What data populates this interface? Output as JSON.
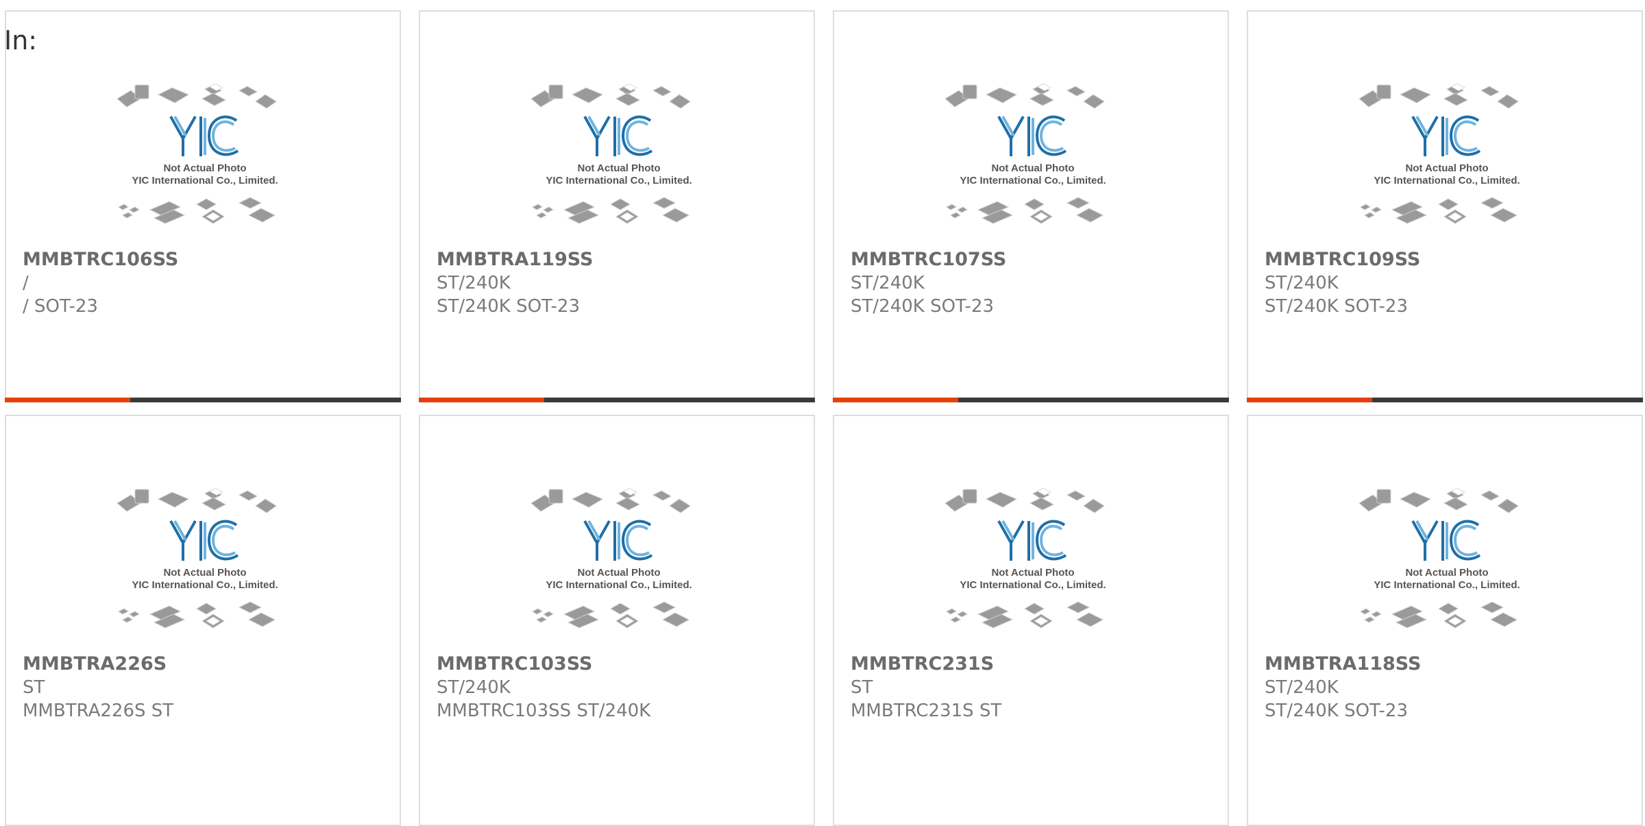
{
  "header": {
    "label": "In:"
  },
  "thumbnail": {
    "logo_text": "YIC",
    "caption_line1": "Not Actual Photo",
    "caption_line2": "YIC International Co., Limited."
  },
  "colors": {
    "accent": "#e8400c",
    "bar": "#3a3a3a",
    "logo": "#1e6fa8"
  },
  "products": [
    {
      "title": "MMBTRC106SS",
      "line1": "/",
      "line2": "/ SOT-23"
    },
    {
      "title": "MMBTRA119SS",
      "line1": "ST/240K",
      "line2": "ST/240K SOT-23"
    },
    {
      "title": "MMBTRC107SS",
      "line1": "ST/240K",
      "line2": "ST/240K SOT-23"
    },
    {
      "title": "MMBTRC109SS",
      "line1": "ST/240K",
      "line2": "ST/240K SOT-23"
    },
    {
      "title": "MMBTRA226S",
      "line1": "ST",
      "line2": "MMBTRA226S ST"
    },
    {
      "title": "MMBTRC103SS",
      "line1": "ST/240K",
      "line2": "MMBTRC103SS ST/240K"
    },
    {
      "title": "MMBTRC231S",
      "line1": "ST",
      "line2": "MMBTRC231S ST"
    },
    {
      "title": "MMBTRA118SS",
      "line1": "ST/240K",
      "line2": "ST/240K SOT-23"
    }
  ]
}
